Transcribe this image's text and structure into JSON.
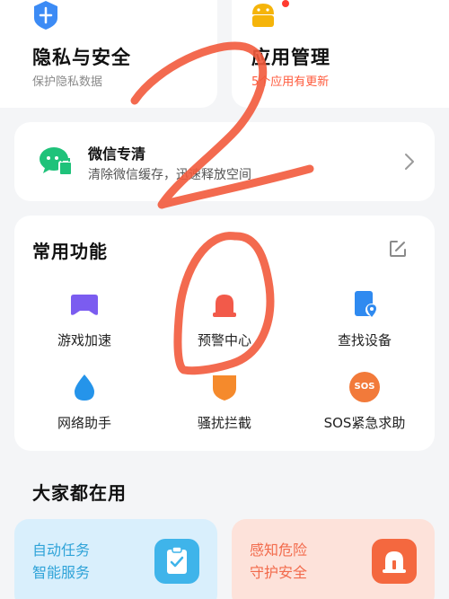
{
  "privacy_card": {
    "title": "隐私与安全",
    "subtitle": "保护隐私数据"
  },
  "apps_card": {
    "title": "应用管理",
    "subtitle": "5个应用有更新",
    "accent": "#ff5a3c"
  },
  "wechat_card": {
    "title": "微信专清",
    "subtitle": "清除微信缓存，迅速释放空间"
  },
  "common_functions": {
    "title": "常用功能",
    "items": [
      {
        "label": "游戏加速",
        "icon": "gamepad-icon"
      },
      {
        "label": "预警中心",
        "icon": "alarm-light-icon"
      },
      {
        "label": "查找设备",
        "icon": "find-device-icon"
      },
      {
        "label": "网络助手",
        "icon": "water-drop-icon"
      },
      {
        "label": "骚扰拦截",
        "icon": "shield-block-icon"
      },
      {
        "label": "SOS紧急求助",
        "icon": "sos-icon"
      }
    ]
  },
  "everyone_uses": {
    "title": "大家都在用",
    "promos": [
      {
        "line1": "自动任务",
        "line2": "智能服务",
        "icon": "clipboard-check-icon",
        "color": "#2fa3d8"
      },
      {
        "line1": "感知危险",
        "line2": "守护安全",
        "icon": "bell-alert-icon",
        "color": "#f26a4b"
      }
    ]
  },
  "sos_badge": "SOS"
}
